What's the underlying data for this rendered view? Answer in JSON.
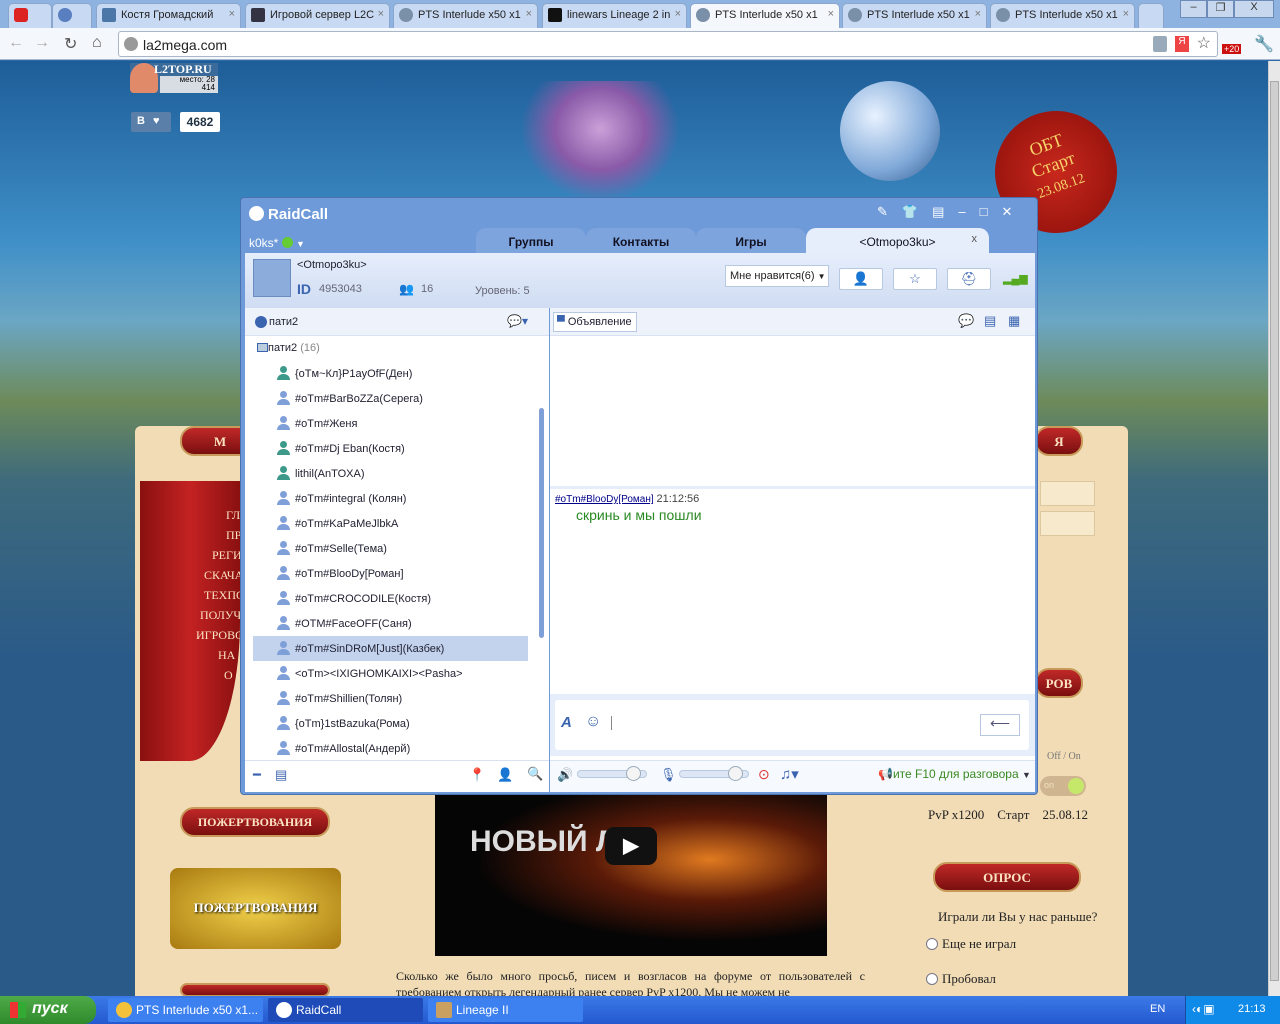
{
  "browser": {
    "tabs": [
      "",
      "",
      "Костя Громадский",
      "Игровой сервер L2C",
      "PTS Interlude x50 x1",
      "linewars Lineage 2 in",
      "PTS Interlude x50 x1",
      "PTS Interlude x50 x1",
      "PTS Interlude x50 x1"
    ],
    "url": "la2mega.com",
    "ext_badge": "+20"
  },
  "site": {
    "l2top": {
      "title": "L2TOP.RU",
      "place": "место: 28",
      "votes": "414"
    },
    "vk": {
      "label": "В",
      "likes": "4682"
    },
    "seal": {
      "line1": "ОБТ",
      "line2": "Старт",
      "line3": "23.08.12"
    },
    "menu": [
      "ГЛ",
      "ПР",
      "РЕГИ",
      "СКАЧА",
      "ТЕХПО",
      "ПОЛУЧ",
      "ИГРОВО",
      "НА",
      "О С"
    ],
    "menu_header": "М",
    "right_header": "Я",
    "donate_btn": "ПОЖЕРТВОВАНИЯ",
    "donate_banner": "ПОЖЕРТВОВАНИЯ",
    "video_text": "НОВЫЙ Л",
    "article": "Сколько же было много просьб, писем и возгласов на форуме от пользователей с требованием открыть легендарный ранее сервер PvP x1200. Мы не можем не",
    "servers_btn": "РОВ",
    "offon": "Off / On",
    "toggle": "on",
    "server_row": {
      "name": "PvP x1200",
      "label": "Старт",
      "date": "25.08.12"
    },
    "poll": {
      "title": "ОПРОС",
      "question": "Играли ли Вы у нас раньше?",
      "options": [
        "Еще не играл",
        "Пробовал"
      ]
    }
  },
  "raidcall": {
    "title": "RaidCall",
    "user": "k0ks*",
    "tabs": [
      "Группы",
      "Контакты",
      "Игры",
      "<Otmopo3ku>"
    ],
    "group": {
      "name": "<Otmopo3ku>",
      "id_label": "ID",
      "id": "4953043",
      "members": "16",
      "level": "Уровень: 5",
      "likes": "Мне нравится(6)"
    },
    "channel": "пати2",
    "announcement": "Объявление",
    "tree": {
      "name": "пати2",
      "count": "(16)"
    },
    "members": [
      {
        "name": "{oTм~Кл}P1ayOfF(Ден)",
        "mobile": true
      },
      {
        "name": "#oTm#BarBoZZa(Серега)"
      },
      {
        "name": "#oTm#Женя"
      },
      {
        "name": "#oTm#Dj Eban(Костя)",
        "mobile": true
      },
      {
        "name": "lithil(AnTOXA)",
        "mobile": true
      },
      {
        "name": "#oTm#integral (Колян)"
      },
      {
        "name": "#oTm#KaPaMeJlbkA"
      },
      {
        "name": "#oTm#Selle(Тема)"
      },
      {
        "name": "#oTm#BlooDy[Роман]"
      },
      {
        "name": "#oTm#CROCODILE(Костя)"
      },
      {
        "name": "#OTM#FaceOFF(Саня)"
      },
      {
        "name": "#oTm#SinDRoM[Just](Казбек)",
        "selected": true
      },
      {
        "name": "<oTm><IXIGHOMKAIXI><Pasha>"
      },
      {
        "name": "#oTm#Shillien(Толян)"
      },
      {
        "name": "{oTm}1stBazuka(Рома)"
      },
      {
        "name": "#oTm#Allostal(Андерй)"
      }
    ],
    "message": {
      "author": "#oTm#BlooDy[Роман]",
      "time": "21:12:56",
      "text": "скринь и мы пошли"
    },
    "ptt": "ите F10 для разговора",
    "speaker_volume": 0.8,
    "mic_volume": 0.8
  },
  "taskbar": {
    "start": "пуск",
    "items": [
      "PTS Interlude x50 x1...",
      "RaidCall",
      "Lineage II"
    ],
    "lang": "EN",
    "clock": "21:13"
  }
}
